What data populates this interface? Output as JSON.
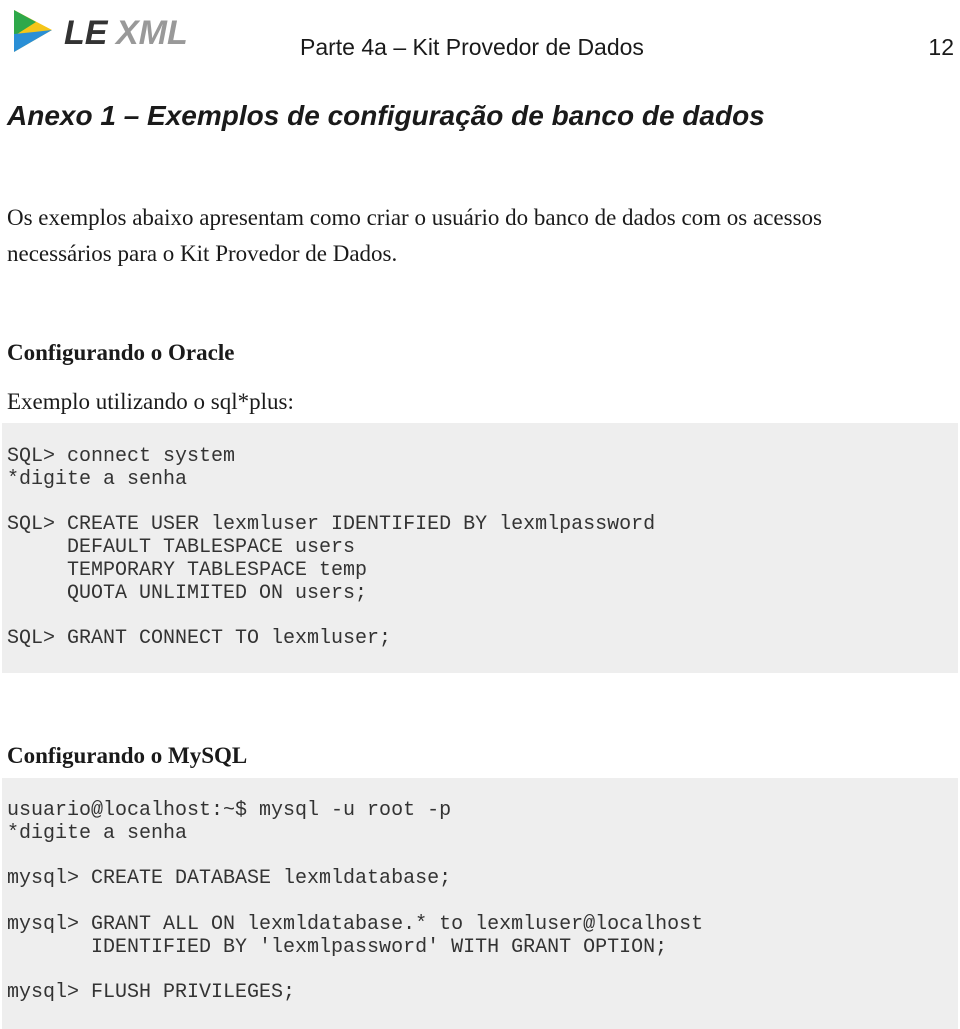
{
  "header": {
    "logo_text": "LEXML",
    "title": "Parte 4a – Kit Provedor de Dados",
    "page_number": "12"
  },
  "section_title": "Anexo 1 – Exemplos de configuração de banco de dados",
  "intro": [
    "Os exemplos abaixo apresentam como criar o usuário do banco de dados com os acessos",
    "necessários para o Kit Provedor de Dados."
  ],
  "oracle": {
    "heading": "Configurando o Oracle",
    "subheading": "Exemplo utilizando o sql*plus:",
    "code": "SQL> connect system\n*digite a senha\n\nSQL> CREATE USER lexmluser IDENTIFIED BY lexmlpassword\n     DEFAULT TABLESPACE users\n     TEMPORARY TABLESPACE temp\n     QUOTA UNLIMITED ON users;\n\nSQL> GRANT CONNECT TO lexmluser;"
  },
  "mysql": {
    "heading": "Configurando o MySQL",
    "code": "usuario@localhost:~$ mysql -u root -p\n*digite a senha\n\nmysql> CREATE DATABASE lexmldatabase;\n\nmysql> GRANT ALL ON lexmldatabase.* to lexmluser@localhost\n       IDENTIFIED BY 'lexmlpassword' WITH GRANT OPTION;\n\nmysql> FLUSH PRIVILEGES;"
  }
}
